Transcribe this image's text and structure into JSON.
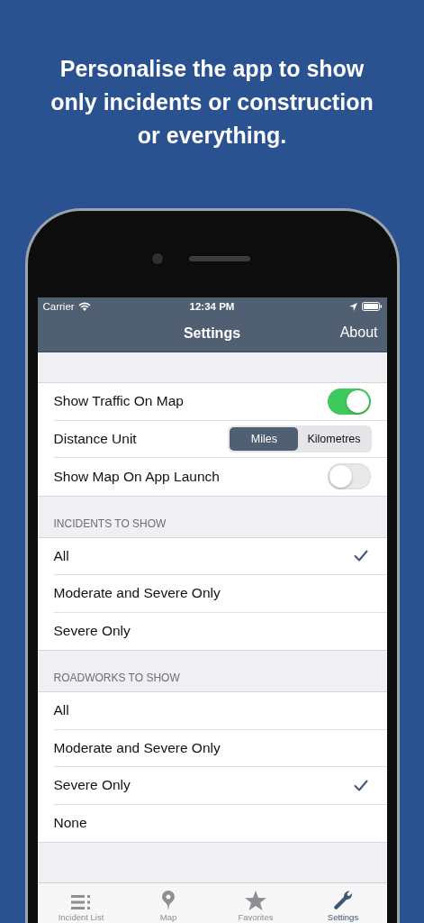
{
  "headline": "Personalise the app to show only incidents or construction or everything.",
  "status_bar": {
    "carrier": "Carrier",
    "time": "12:34 PM"
  },
  "nav_bar": {
    "title": "Settings",
    "right_button": "About"
  },
  "general": [
    {
      "kind": "toggle",
      "label": "Show Traffic On Map",
      "on": true
    },
    {
      "kind": "segmented",
      "label": "Distance Unit",
      "segments": [
        {
          "label": "Miles",
          "selected": true
        },
        {
          "label": "Kilometres",
          "selected": false
        }
      ]
    },
    {
      "kind": "toggle",
      "label": "Show Map On App Launch",
      "on": false
    }
  ],
  "sections": [
    {
      "header": "INCIDENTS TO SHOW",
      "options": [
        {
          "label": "All",
          "selected": true
        },
        {
          "label": "Moderate and Severe Only",
          "selected": false
        },
        {
          "label": "Severe Only",
          "selected": false
        }
      ]
    },
    {
      "header": "ROADWORKS TO SHOW",
      "options": [
        {
          "label": "All",
          "selected": false
        },
        {
          "label": "Moderate and Severe Only",
          "selected": false
        },
        {
          "label": "Severe Only",
          "selected": true
        },
        {
          "label": "None",
          "selected": false
        }
      ]
    }
  ],
  "tab_bar": [
    {
      "kind": "list",
      "label": "Incident List",
      "selected": false
    },
    {
      "kind": "pin",
      "label": "Map",
      "selected": false
    },
    {
      "kind": "star",
      "label": "Favorites",
      "selected": false
    },
    {
      "kind": "wrench",
      "label": "Settings",
      "selected": true
    }
  ]
}
